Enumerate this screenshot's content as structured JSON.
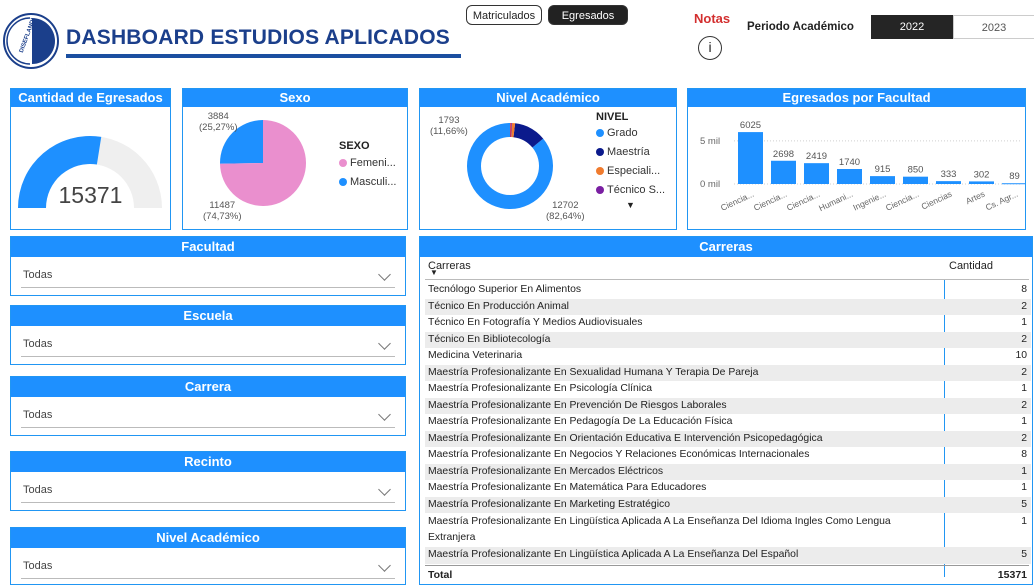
{
  "header": {
    "logo_text": "DISEFLANDI",
    "title": "DASHBOARD ESTUDIOS APLICADOS",
    "toggle_matriculados": "Matriculados",
    "toggle_egresados": "Egresados",
    "notas_label": "Notas",
    "info_glyph": "i",
    "periodo_label": "Periodo Académico",
    "years": [
      "2022",
      "2023"
    ]
  },
  "colors": {
    "accent": "#1e90ff",
    "title": "#1b3f8b",
    "pink": "#ea8fce",
    "navy": "#0b1a8c",
    "orange": "#f07b2e",
    "purple": "#7a1fa2",
    "red": "#d32f2f"
  },
  "egresados": {
    "title": "Cantidad de Egresados",
    "value": "15371",
    "gauge_fraction": 0.55
  },
  "sexo": {
    "title": "Sexo",
    "legend_title": "SEXO",
    "slices": [
      {
        "name": "Femeni...",
        "value": 11487,
        "label": "11487",
        "pct": "(74,73%)",
        "color": "#ea8fce"
      },
      {
        "name": "Masculi...",
        "value": 3884,
        "label": "3884",
        "pct": "(25,27%)",
        "color": "#1e90ff"
      }
    ]
  },
  "nivel": {
    "title": "Nivel Académico",
    "legend_title": "NIVEL",
    "legend": [
      {
        "name": "Grado",
        "color": "#1e90ff"
      },
      {
        "name": "Maestría",
        "color": "#0b1a8c"
      },
      {
        "name": "Especiali...",
        "color": "#f07b2e"
      },
      {
        "name": "Técnico S...",
        "color": "#7a1fa2"
      }
    ],
    "slices": [
      {
        "value": 12702,
        "color": "#1e90ff"
      },
      {
        "value": 1793,
        "color": "#0b1a8c"
      },
      {
        "value": 180,
        "color": "#f07b2e"
      },
      {
        "value": 60,
        "color": "#7a1fa2"
      },
      {
        "value": 40,
        "color": "#e53935"
      }
    ],
    "label_big": "12702",
    "label_big_pct": "(82,64%)",
    "label_small": "1793",
    "label_small_pct": "(11,66%)",
    "more_glyph": "▼"
  },
  "facultad_chart": {
    "title": "Egresados por Facultad",
    "chart_data": {
      "type": "bar",
      "categories": [
        "Ciencia...",
        "Ciencia...",
        "Ciencia...",
        "Humani...",
        "Ingenie...",
        "Ciencia...",
        "Ciencias",
        "Artes",
        "Cs. Agr..."
      ],
      "values": [
        6025,
        2698,
        2419,
        1740,
        915,
        850,
        333,
        302,
        89
      ],
      "ytick_labels": [
        "5 mil",
        "0 mil"
      ],
      "ytick_values": [
        5000,
        0
      ],
      "ylim": [
        0,
        6500
      ]
    }
  },
  "slicers": [
    {
      "title": "Facultad",
      "value": "Todas"
    },
    {
      "title": "Escuela",
      "value": "Todas"
    },
    {
      "title": "Carrera",
      "value": "Todas"
    },
    {
      "title": "Recinto",
      "value": "Todas"
    },
    {
      "title": "Nivel Académico",
      "value": "Todas"
    }
  ],
  "carreras": {
    "title": "Carreras",
    "col_name": "Carreras",
    "col_count": "Cantidad",
    "rows": [
      {
        "name": "Tecnólogo Superior En Alimentos",
        "count": "8"
      },
      {
        "name": "Técnico En Producción Animal",
        "count": "2"
      },
      {
        "name": "Técnico En Fotografía Y Medios Audiovisuales",
        "count": "1"
      },
      {
        "name": "Técnico En Bibliotecología",
        "count": "2"
      },
      {
        "name": "Medicina Veterinaria",
        "count": "10"
      },
      {
        "name": "Maestría Profesionalizante En Sexualidad Humana Y Terapia De Pareja",
        "count": "2"
      },
      {
        "name": "Maestría Profesionalizante En Psicología Clínica",
        "count": "1"
      },
      {
        "name": "Maestría Profesionalizante En Prevención De Riesgos Laborales",
        "count": "2"
      },
      {
        "name": "Maestría Profesionalizante En Pedagogía De La Educación Física",
        "count": "1"
      },
      {
        "name": "Maestría Profesionalizante En Orientación Educativa E Intervención Psicopedagógica",
        "count": "2"
      },
      {
        "name": "Maestría Profesionalizante En Negocios Y Relaciones Económicas Internacionales",
        "count": "8"
      },
      {
        "name": "Maestría Profesionalizante En Mercados Eléctricos",
        "count": "1"
      },
      {
        "name": "Maestría Profesionalizante En Matemática Para Educadores",
        "count": "1"
      },
      {
        "name": "Maestría Profesionalizante En Marketing Estratégico",
        "count": "5"
      }
    ],
    "long_row": {
      "line1": "Maestría Profesionalizante En Lingüística Aplicada A La Enseñanza Del Idioma Ingles Como Lengua",
      "line2": "Extranjera",
      "count": "1"
    },
    "last_row": {
      "name": "Maestría Profesionalizante En Lingüística Aplicada A La Enseñanza Del Español",
      "count": "5"
    },
    "total_label": "Total",
    "total_value": "15371"
  }
}
